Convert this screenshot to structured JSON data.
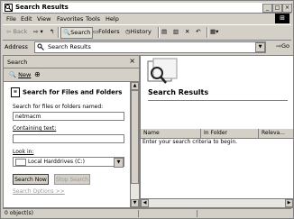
{
  "window": {
    "title": "Search Results",
    "controls": [
      "_",
      "□",
      "×"
    ]
  },
  "menu": [
    {
      "label": "File"
    },
    {
      "label": "Edit"
    },
    {
      "label": "View"
    },
    {
      "label": "Favorites"
    },
    {
      "label": "Tools"
    },
    {
      "label": "Help"
    }
  ],
  "toolbar": {
    "back": "Back",
    "search": "Search",
    "folders": "Folders",
    "history": "History"
  },
  "address": {
    "label": "Address",
    "value": "Search Results",
    "go": "Go"
  },
  "search_pane": {
    "header": "Search",
    "new_label": "New",
    "title": "Search for Files and Folders",
    "named_label": "Search for files or folders named:",
    "named_value": "netmacm",
    "containing_label": "Containing text:",
    "containing_value": "",
    "lookin_label": "Look in:",
    "lookin_value": "Local Harddrives (C:)",
    "search_now": "Search Now",
    "stop_search": "Stop Search",
    "options": "Search Options  >>"
  },
  "results": {
    "title": "Search Results",
    "columns": [
      "Name",
      "In Folder",
      "Releva..."
    ],
    "message": "Enter your search criteria to begin."
  },
  "status": {
    "text": "0 object(s)"
  },
  "colors": {
    "chrome": "#d4d0c8",
    "border": "#808080",
    "disabled": "#9a9a9a"
  }
}
